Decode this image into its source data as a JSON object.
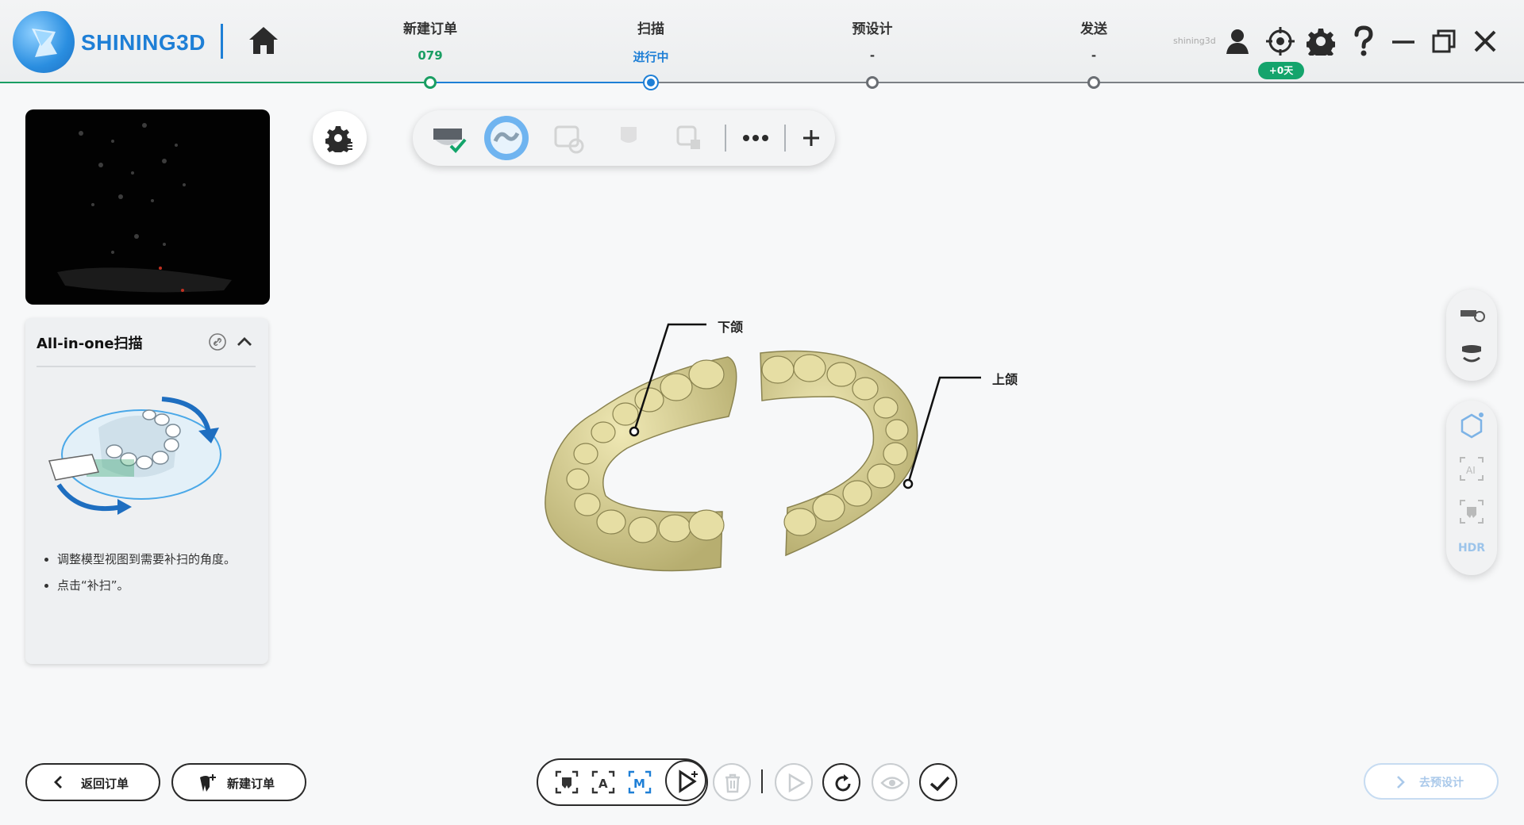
{
  "app": {
    "brand": "SHINING3D",
    "user": "shining3d",
    "days_badge": "+0天"
  },
  "steps": [
    {
      "title": "新建订单",
      "sub": "079",
      "color": "#1a9e63"
    },
    {
      "title": "扫描",
      "sub": "进行中",
      "color": "#1e7fd6"
    },
    {
      "title": "预设计",
      "sub": "-",
      "color": "#333333"
    },
    {
      "title": "发送",
      "sub": "-",
      "color": "#333333"
    }
  ],
  "panel": {
    "title": "All-in-one扫描",
    "bullets": [
      "调整模型视图到需要补扫的角度。",
      "点击“补扫”。"
    ]
  },
  "labels": {
    "lower_jaw": "下颌",
    "upper_jaw": "上颌"
  },
  "rightpanel": {
    "hdr": "HDR"
  },
  "bottom": {
    "back_label": "返回订单",
    "new_order_label": "新建订单",
    "next_label": "去预设计"
  },
  "colors": {
    "accent": "#1e7fd6",
    "green": "#1a9e63",
    "model": "#d8d29a"
  }
}
